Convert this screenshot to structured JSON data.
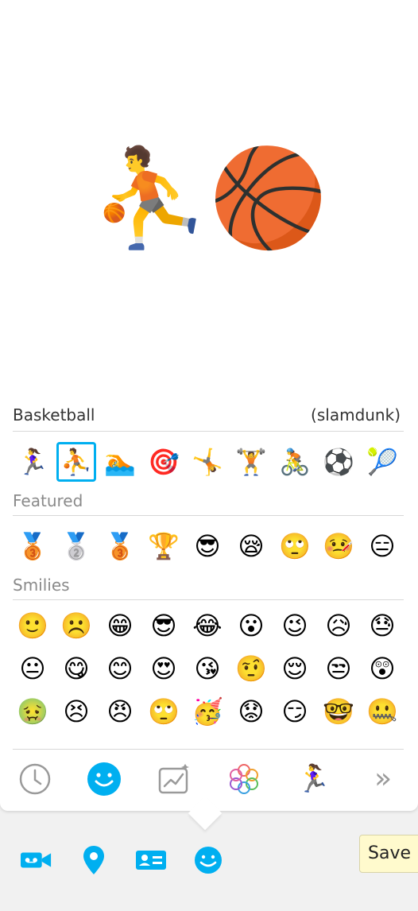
{
  "preview": {
    "emoji": "⛹🏀",
    "name": "Basketball",
    "code": "(slamdunk)"
  },
  "sports_row": [
    "🏃‍♀️",
    "⛹️",
    "🏊",
    "🎯",
    "🤸",
    "🏋️",
    "🚴",
    "⚽",
    "🎾"
  ],
  "sections": {
    "featured": {
      "title": "Featured",
      "items": [
        "🥉",
        "🥈",
        "🥉",
        "🏆",
        "😎",
        "😪",
        "🙄",
        "🤒",
        "😑"
      ]
    },
    "smilies": {
      "title": "Smilies",
      "rows": [
        [
          "🙂",
          "☹️",
          "😁",
          "😎",
          "😂",
          "😮",
          "😉",
          "😥",
          "😓"
        ],
        [
          "😐",
          "😋",
          "😊",
          "😍",
          "😘",
          "🤨",
          "😌",
          "😒",
          "😲"
        ],
        [
          "🤢",
          "😣",
          "😠",
          "🙄",
          "🥳",
          "😟",
          "😏",
          "🤓",
          "🤐"
        ]
      ]
    }
  },
  "tabs": [
    "recent-icon",
    "smiley-icon",
    "trending-icon",
    "flower-icon",
    "runner-icon",
    "more-icon"
  ],
  "tab_runner": "🏃‍♀️",
  "tab_more": "»",
  "tooltip": "Save i",
  "colors": {
    "accent": "#00aff0",
    "gray": "#9a9a9a"
  }
}
